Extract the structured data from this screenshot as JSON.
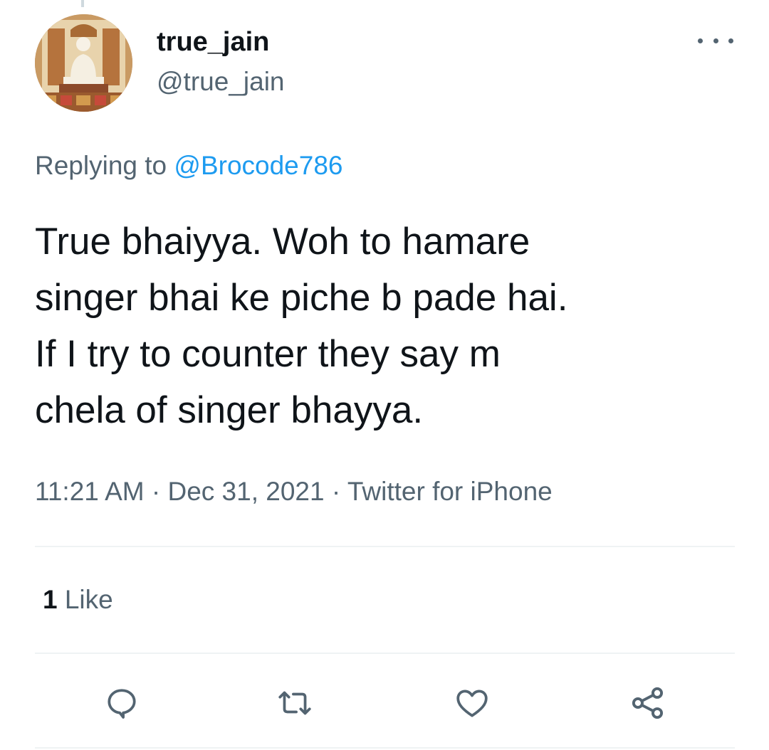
{
  "author": {
    "display_name": "true_jain",
    "handle": "@true_jain",
    "avatar_icon": "jain-idol-avatar"
  },
  "reply": {
    "prefix": "Replying to",
    "mention": "@Brocode786"
  },
  "tweet": {
    "lines": [
      "True bhaiyya. Woh to hamare",
      "singer bhai ke piche b pade hai.",
      "If I try to counter they say m",
      "chela of singer bhayya."
    ],
    "time": "11:21 AM",
    "date": "Dec 31, 2021",
    "source": "Twitter for iPhone",
    "separator": "·"
  },
  "stats": {
    "like_count": "1",
    "like_label": "Like"
  },
  "actions": {
    "reply_icon": "reply-icon",
    "retweet_icon": "retweet-icon",
    "like_icon": "heart-icon",
    "share_icon": "share-icon"
  },
  "colors": {
    "text": "#0f1419",
    "secondary": "#536471",
    "link": "#1d9bf0",
    "divider": "#eff3f4"
  }
}
